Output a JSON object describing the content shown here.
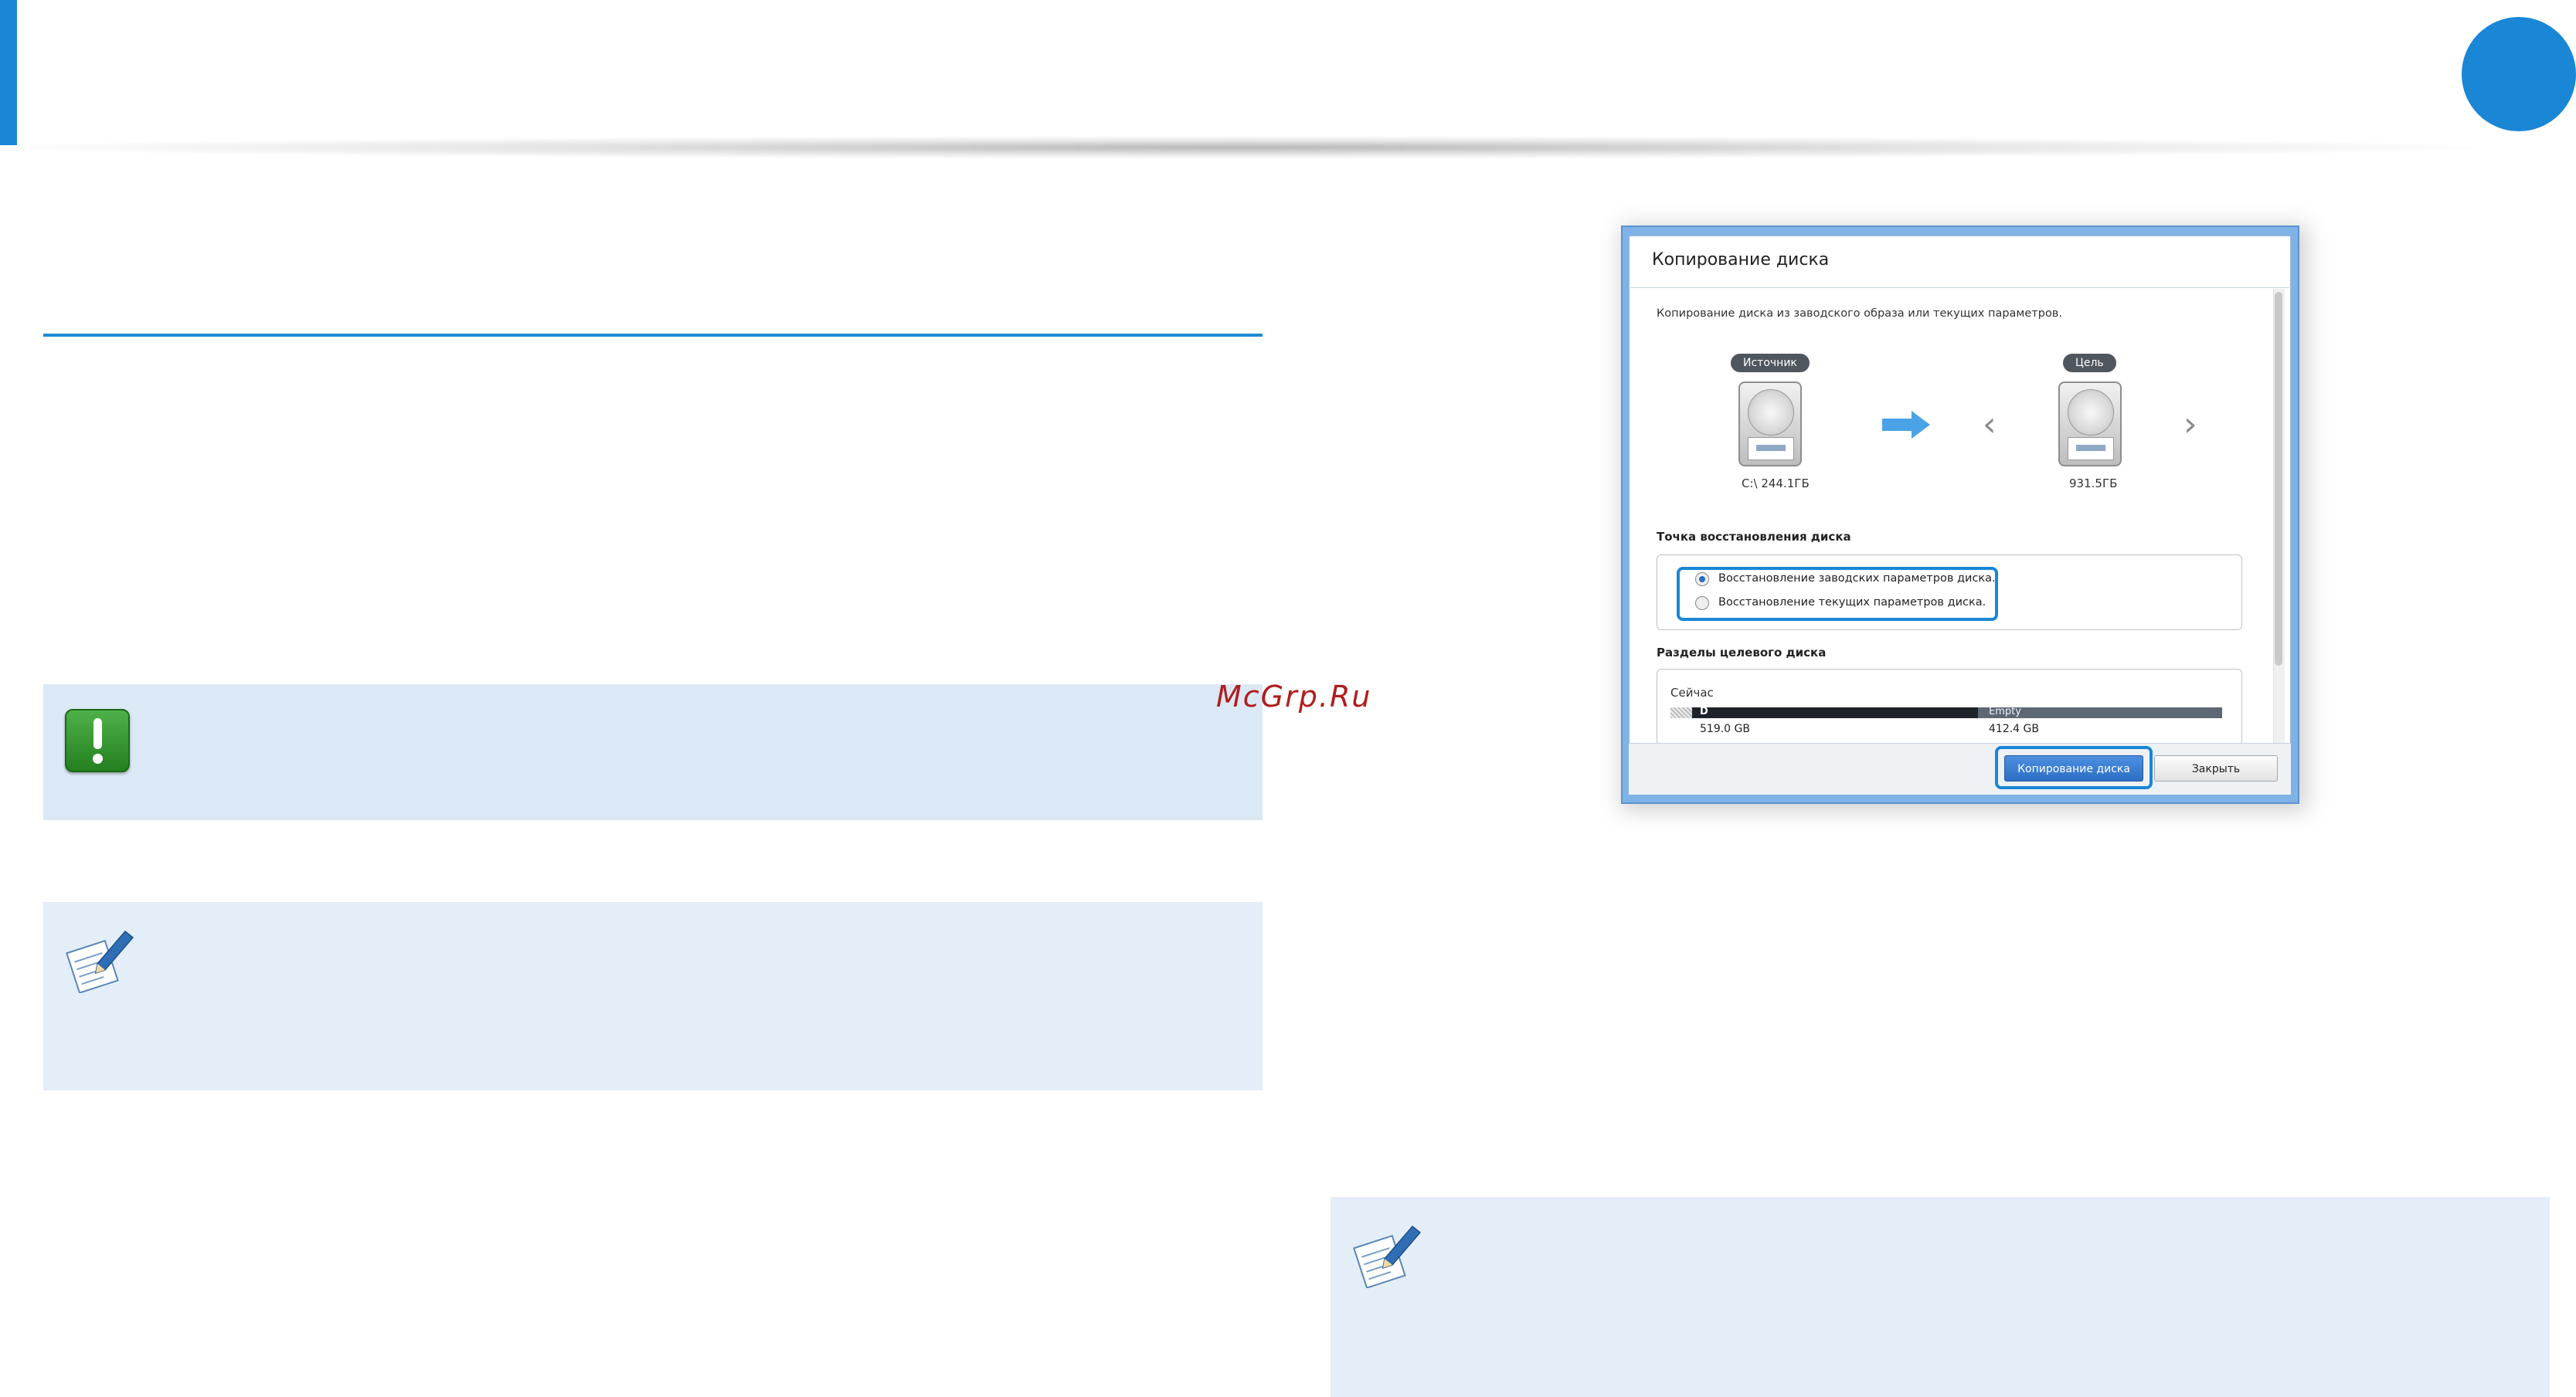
{
  "watermark": "McGrp.Ru",
  "dialog": {
    "title": "Копирование диска",
    "description": "Копирование диска из заводского образа или текущих параметров.",
    "source_label": "Источник",
    "target_label": "Цель",
    "source_caption": "C:\\ 244.1ГБ",
    "target_caption": "931.5ГБ",
    "restore_point": {
      "title": "Точка восстановления диска",
      "options": [
        {
          "label": "Восстановление заводских параметров диска.",
          "selected": true
        },
        {
          "label": "Восстановление текущих параметров диска.",
          "selected": false
        }
      ]
    },
    "partitions": {
      "title": "Разделы целевого диска",
      "now_label": "Сейчас",
      "items": [
        {
          "name": "D",
          "size": "519.0 GB"
        },
        {
          "name": "Empty",
          "size": "412.4 GB"
        }
      ]
    },
    "buttons": {
      "copy": "Копирование диска",
      "close": "Закрыть"
    }
  },
  "icons": {
    "caution": "caution-exclamation-icon",
    "note": "note-pencil-icon",
    "arrow": "arrow-right-icon",
    "prev": "chevron-left-icon",
    "next": "chevron-right-icon"
  },
  "colors": {
    "accent": "#1a86d6",
    "box_bg": "#e4eef8",
    "caution_green": "#3aa035",
    "watermark": "#b01d1d"
  }
}
